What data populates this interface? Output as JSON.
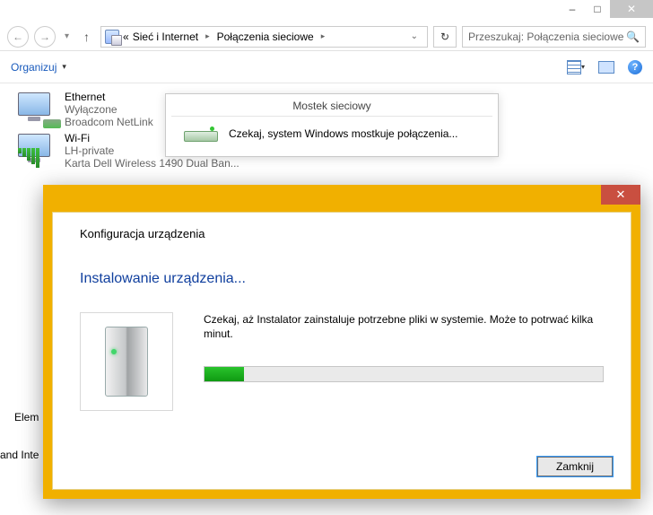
{
  "titlebar": {
    "min": "–",
    "max": "□",
    "close": "✕"
  },
  "nav": {
    "back": "←",
    "forward": "→",
    "dropdown": "▾",
    "up": "↑",
    "chevrons": "«",
    "crumb1": "Sieć i Internet",
    "crumb2": "Połączenia sieciowe",
    "sep": "▸",
    "addr_dd": "⌄",
    "refresh": "↻"
  },
  "search": {
    "placeholder": "Przeszukaj: Połączenia sieciowe",
    "icon": "🔍"
  },
  "toolbar": {
    "organize": "Organizuj",
    "caret": "▾",
    "help": "?"
  },
  "items": {
    "eth": {
      "title": "Ethernet",
      "sub": "Wyłączone",
      "adapter": "Broadcom NetLink"
    },
    "wifi": {
      "title": "Wi-Fi",
      "sub": "LH-private",
      "adapter": "Karta Dell Wireless 1490 Dual Ban..."
    }
  },
  "bridge": {
    "title": "Mostek sieciowy",
    "text": "Czekaj, system Windows mostkuje połączenia..."
  },
  "dlg": {
    "close": "✕",
    "header": "Konfiguracja urządzenia",
    "blue": "Instalowanie urządzenia...",
    "msg": "Czekaj, aż Instalator zainstaluje potrzebne pliki w systemie. Może to potrwać kilka minut.",
    "button": "Zamknij",
    "progress_pct": 10
  },
  "footer": {
    "elem": "Elem",
    "and_inte": "and Inte"
  }
}
